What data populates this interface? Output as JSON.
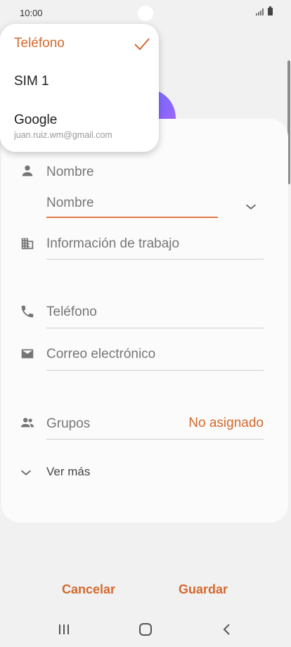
{
  "status_bar": {
    "time": "10:00"
  },
  "account_dropdown": {
    "options": [
      {
        "label": "Teléfono",
        "selected": true
      },
      {
        "label": "SIM 1"
      },
      {
        "label": "Google",
        "detail": "juan.ruiz.wm@gmail.com"
      }
    ]
  },
  "form": {
    "name_section_label": "Nombre",
    "name_input_placeholder": "Nombre",
    "work_info_label": "Información de trabajo",
    "phone_label": "Teléfono",
    "email_label": "Correo electrónico",
    "groups_label": "Grupos",
    "groups_value": "No asignado",
    "see_more_label": "Ver más"
  },
  "actions": {
    "cancel_label": "Cancelar",
    "save_label": "Guardar"
  },
  "icons": {
    "person": "person-icon",
    "work": "building-icon",
    "phone": "phone-icon",
    "email": "mail-icon",
    "groups": "group-icon",
    "check": "check-icon",
    "chevron": "chevron-down-icon"
  },
  "colors": {
    "accent": "#d4692d",
    "background": "#f1f1f1",
    "card": "#fbfbfb"
  }
}
